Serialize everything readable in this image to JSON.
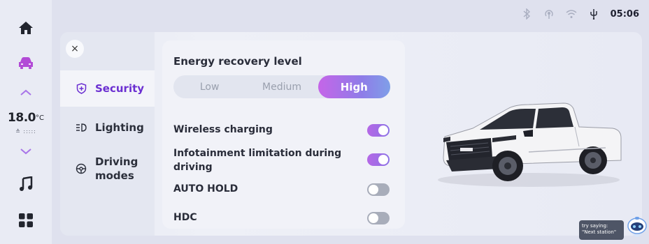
{
  "status_bar": {
    "time": "05:06",
    "icons": [
      "bluetooth-icon",
      "hotspot-icon",
      "wifi-icon",
      "usb-icon"
    ]
  },
  "rail": {
    "items": [
      "home-icon",
      "car-icon",
      "chevron-up-icon",
      "temperature",
      "chevron-down-icon",
      "music-icon",
      "apps-grid-icon"
    ],
    "temperature": {
      "value": "18.0",
      "unit": "°C"
    },
    "fan": "≛ :::::"
  },
  "nav": {
    "items": [
      {
        "label": "Security",
        "icon": "shield-icon",
        "active": true
      },
      {
        "label": "Lighting",
        "icon": "headlight-icon",
        "active": false
      },
      {
        "label": "Driving modes",
        "icon": "steering-wheel-icon",
        "active": false
      }
    ],
    "close_label": "×"
  },
  "settings": {
    "energy_title": "Energy recovery level",
    "energy_options": [
      "Low",
      "Medium",
      "High"
    ],
    "energy_selected": "High",
    "rows": [
      {
        "label": "Wireless charging",
        "on": true
      },
      {
        "label": "Infotainment limitation during driving",
        "on": true
      },
      {
        "label": "AUTO HOLD",
        "on": false
      },
      {
        "label": "HDC",
        "on": false
      }
    ]
  },
  "assistant": {
    "hint": "try saying: \"Next station\""
  },
  "colors": {
    "accent": "#6b2fd1",
    "toggle_on": "#9a6fe6",
    "toggle_off": "#a8adba"
  }
}
